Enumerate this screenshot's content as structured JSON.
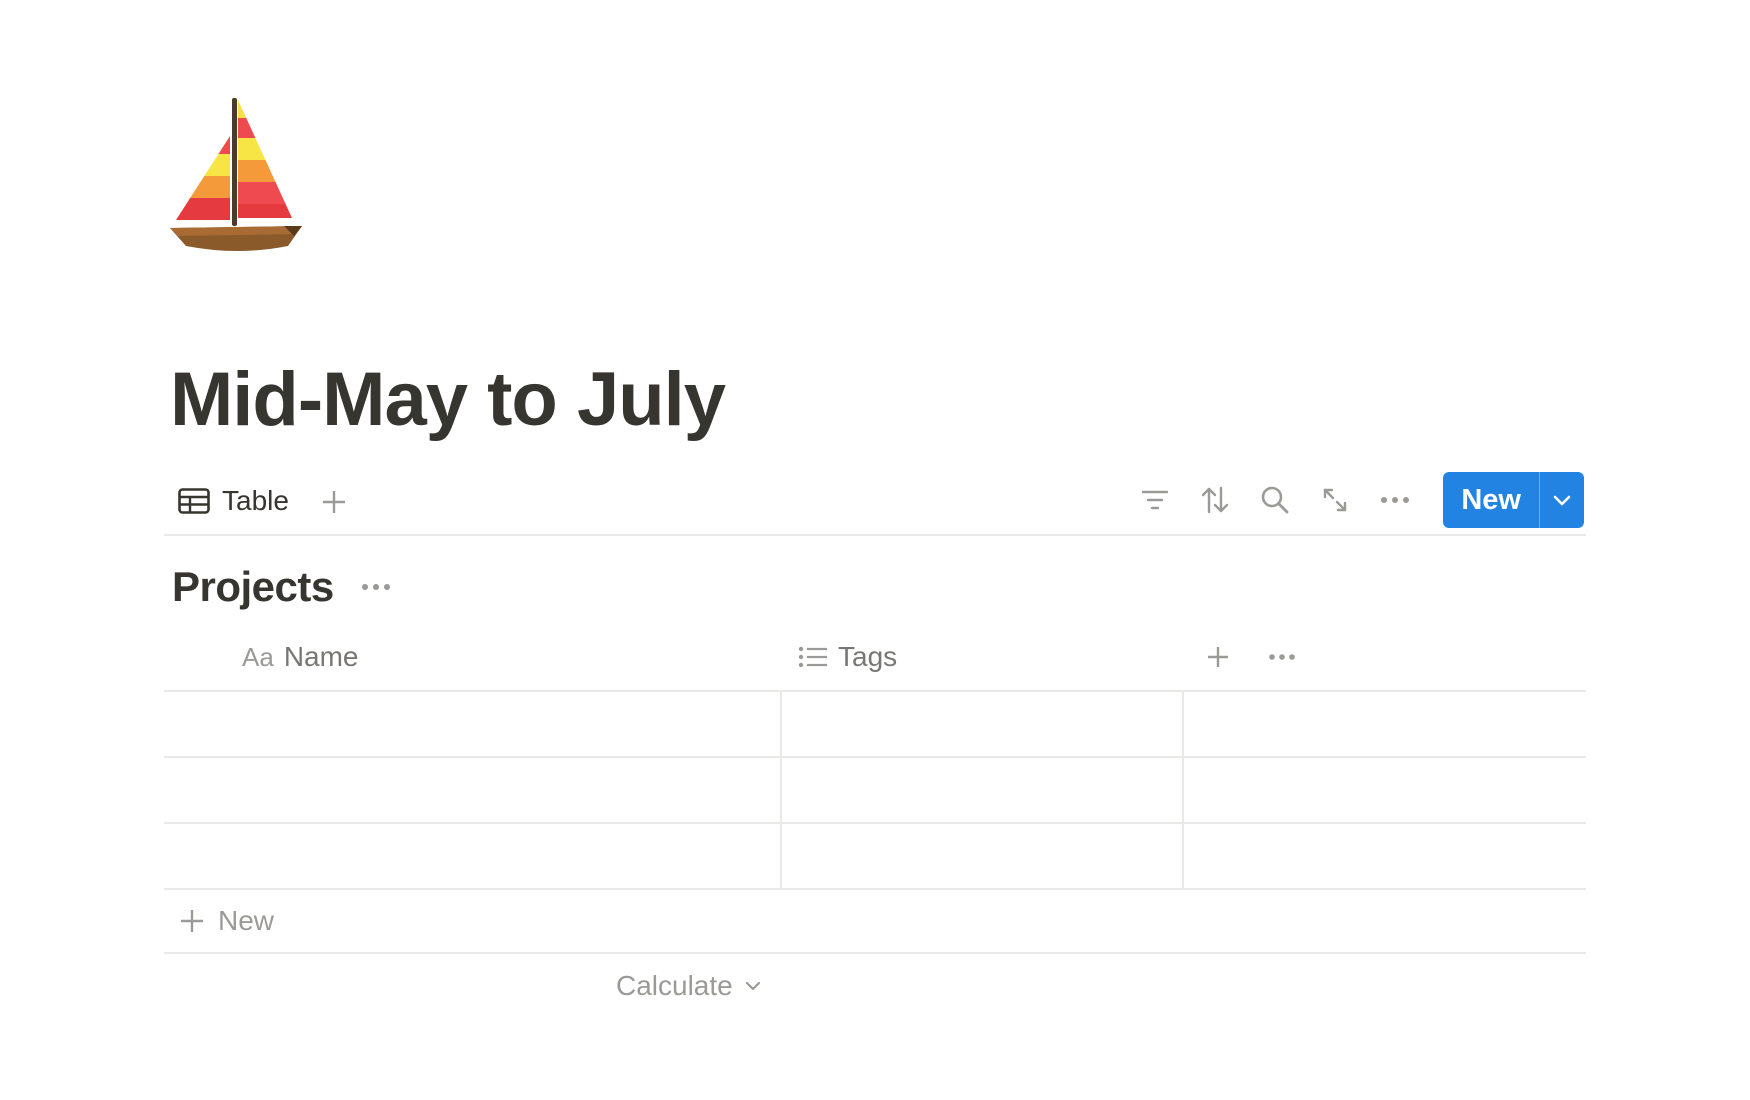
{
  "page": {
    "icon": "sailboat-emoji",
    "title": "Mid-May to July"
  },
  "view_bar": {
    "active_view": {
      "icon": "table-icon",
      "label": "Table"
    },
    "add_view_icon": "plus-icon",
    "toolbar": {
      "filter_icon": "filter-icon",
      "sort_icon": "sort-icon",
      "search_icon": "search-icon",
      "expand_icon": "expand-icon",
      "more_icon": "more-icon",
      "new_button_label": "New",
      "new_dropdown_icon": "chevron-down-icon"
    },
    "accent_color": "#2383e2"
  },
  "database": {
    "title": "Projects",
    "more_icon": "more-icon",
    "columns": [
      {
        "icon": "text-property-icon",
        "icon_text": "Aa",
        "label": "Name"
      },
      {
        "icon": "list-property-icon",
        "label": "Tags"
      }
    ],
    "add_column_icon": "plus-icon",
    "column_more_icon": "more-icon",
    "rows": [
      {
        "name": "",
        "tags": ""
      },
      {
        "name": "",
        "tags": ""
      },
      {
        "name": "",
        "tags": ""
      }
    ],
    "new_row_label": "New",
    "calculate_label": "Calculate"
  }
}
